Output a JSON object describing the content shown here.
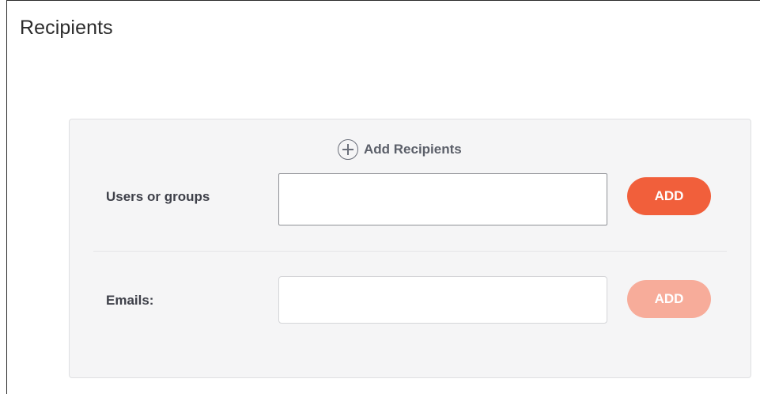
{
  "section": {
    "title": "Recipients"
  },
  "panel": {
    "add_recipients_label": "Add Recipients",
    "users_row": {
      "label": "Users or groups",
      "input_value": "",
      "button_label": "ADD"
    },
    "emails_row": {
      "label": "Emails:",
      "input_value": "",
      "button_label": "ADD"
    }
  },
  "colors": {
    "accent": "#f15f3b",
    "accent_disabled": "#f7ac9a",
    "panel_background": "#f5f5f6"
  },
  "icons": {
    "add_recipients": "plus-circle-icon"
  }
}
